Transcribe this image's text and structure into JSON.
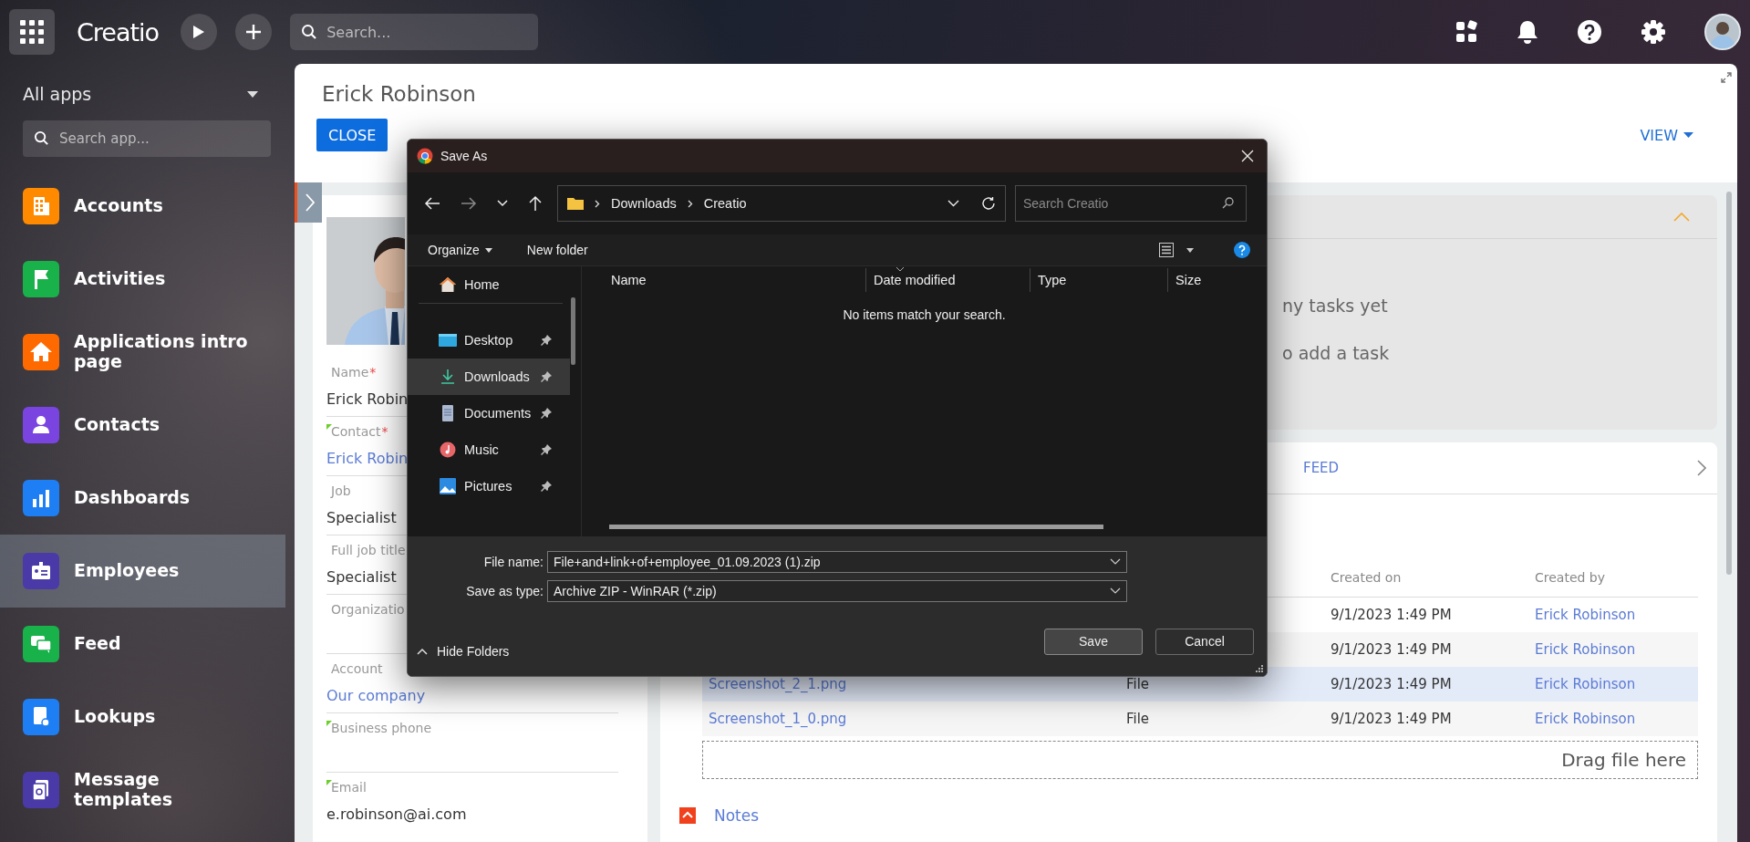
{
  "top_bar": {
    "logo": "Creatio",
    "search": {
      "placeholder": "Search..."
    }
  },
  "sidebar": {
    "title": "All apps",
    "search": {
      "placeholder": "Search app..."
    },
    "items": [
      {
        "label": "Accounts",
        "color": "#ff8a00",
        "selected": false
      },
      {
        "label": "Activities",
        "color": "#18b14a",
        "selected": false
      },
      {
        "label": "Applications intro page",
        "color": "#ff6a00",
        "selected": false
      },
      {
        "label": "Contacts",
        "color": "#7a44e0",
        "selected": false
      },
      {
        "label": "Dashboards",
        "color": "#1e7ff5",
        "selected": false
      },
      {
        "label": "Employees",
        "color": "#4a3aa8",
        "selected": true
      },
      {
        "label": "Feed",
        "color": "#18b14a",
        "selected": false
      },
      {
        "label": "Lookups",
        "color": "#1e7ff5",
        "selected": false
      },
      {
        "label": "Message templates",
        "color": "#4a3aa8",
        "selected": false
      }
    ]
  },
  "record": {
    "title": "Erick Robinson",
    "close_button": "CLOSE",
    "view_button": "VIEW",
    "fields": [
      {
        "label": "Name",
        "required_mark": "*",
        "marked": false,
        "kind": "text",
        "value": "Erick Robin"
      },
      {
        "label": "Contact",
        "required_mark": "*",
        "marked": true,
        "kind": "link",
        "value": "Erick Robin"
      },
      {
        "label": "Job",
        "marked": false,
        "kind": "text",
        "value": "Specialist"
      },
      {
        "label": "Full job title",
        "marked": false,
        "kind": "text",
        "value": "Specialist"
      },
      {
        "label": "Organizatio",
        "marked": false
      },
      {
        "label": "Account",
        "marked": false,
        "kind": "link",
        "value": "Our company"
      },
      {
        "label": "Business phone",
        "marked": true
      },
      {
        "label": "Email",
        "marked": true,
        "kind": "text",
        "value": "e.robinson@ai.com"
      }
    ]
  },
  "tasks": {
    "expanded": true,
    "lines": [
      "ny tasks yet",
      "o add a task"
    ]
  },
  "tabs": [
    {
      "label": "FEED",
      "selected": false
    }
  ],
  "files": {
    "columns": [
      "Created on",
      "Created by"
    ],
    "rows": [
      {
        "created_on": "9/1/2023 1:49 PM",
        "created_by": "Erick Robinson",
        "selected": false
      },
      {
        "created_on": "9/1/2023 1:49 PM",
        "created_by": "Erick Robinson",
        "selected": false
      },
      {
        "name": "Screenshot_2_1.png",
        "type": "File",
        "created_on": "9/1/2023 1:49 PM",
        "created_by": "Erick Robinson",
        "selected": true
      },
      {
        "name": "Screenshot_1_0.png",
        "type": "File",
        "created_on": "9/1/2023 1:49 PM",
        "created_by": "Erick Robinson",
        "selected": false
      }
    ],
    "drop_zone": "Drag file here"
  },
  "notes": {
    "label": "Notes"
  },
  "dialog": {
    "title": "Save As",
    "path": [
      "Downloads",
      "Creatio"
    ],
    "search": {
      "placeholder": "Search Creatio"
    },
    "organize": "Organize",
    "new_folder": "New folder",
    "nav_top": [
      {
        "label": "Home",
        "pinned": false,
        "selected": false
      }
    ],
    "nav": [
      {
        "label": "Desktop",
        "pinned": true,
        "selected": false
      },
      {
        "label": "Downloads",
        "pinned": true,
        "selected": true
      },
      {
        "label": "Documents",
        "pinned": true,
        "selected": false
      },
      {
        "label": "Music",
        "pinned": true,
        "selected": false
      },
      {
        "label": "Pictures",
        "pinned": true,
        "selected": false
      }
    ],
    "columns": [
      "Name",
      "Date modified",
      "Type",
      "Size"
    ],
    "empty_message": "No items match your search.",
    "file_name": {
      "label": "File name:",
      "value": "File+and+link+of+employee_01.09.2023 (1).zip"
    },
    "save_type": {
      "label": "Save as type:",
      "value": "Archive ZIP - WinRAR (*.zip)"
    },
    "hide_folders": "Hide Folders",
    "buttons": [
      {
        "label": "Save",
        "default": true
      },
      {
        "label": "Cancel",
        "default": false
      }
    ]
  }
}
